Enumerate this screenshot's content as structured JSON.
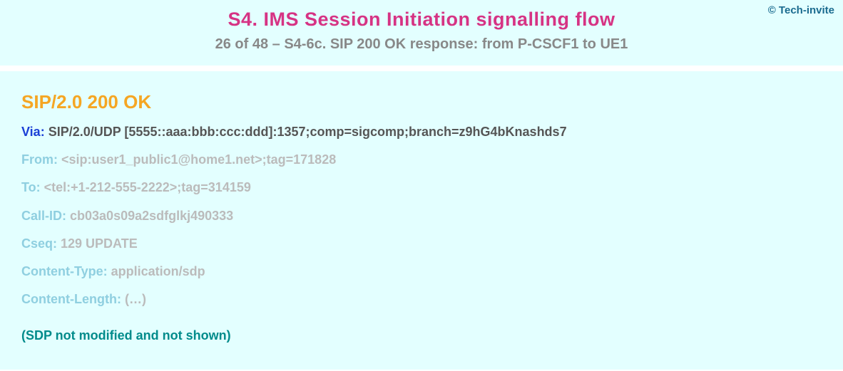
{
  "copyright": "© Tech-invite",
  "header": {
    "title": "S4. IMS Session Initiation signalling flow",
    "subtitle": "26 of 48 – S4-6c. SIP 200 OK response: from P-CSCF1 to UE1"
  },
  "sip": {
    "status_line": "SIP/2.0 200 OK",
    "headers": [
      {
        "name": "Via",
        "sep": ": ",
        "value": "SIP/2.0/UDP [5555::aaa:bbb:ccc:ddd]:1357;comp=sigcomp;branch=z9hG4bKnashds7",
        "style": "via"
      },
      {
        "name": "From",
        "sep": ": ",
        "value": "<sip:user1_public1@home1.net>;tag=171828",
        "style": "faded"
      },
      {
        "name": "To",
        "sep": ": ",
        "value": "<tel:+1-212-555-2222>;tag=314159",
        "style": "faded"
      },
      {
        "name": "Call-ID",
        "sep": ": ",
        "value": "cb03a0s09a2sdfglkj490333",
        "style": "faded"
      },
      {
        "name": "Cseq",
        "sep": ": ",
        "value": "129 UPDATE",
        "style": "faded"
      },
      {
        "name": "Content-Type",
        "sep": ": ",
        "value": "application/sdp",
        "style": "faded"
      },
      {
        "name": "Content-Length",
        "sep": ": ",
        "value": "(…)",
        "style": "faded"
      }
    ],
    "note": "(SDP not modified and not shown)"
  }
}
